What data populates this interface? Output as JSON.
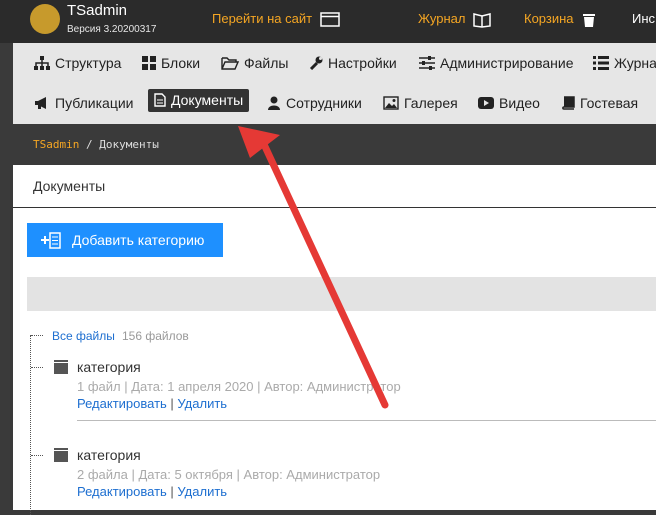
{
  "header": {
    "brand": "TSadmin",
    "version": "Версия 3.20200317",
    "links": [
      "Перейти на сайт",
      "Журнал",
      "Корзина",
      "Инс"
    ]
  },
  "menu1": [
    "Структура",
    "Блоки",
    "Файлы",
    "Настройки",
    "Администрирование",
    "Журна"
  ],
  "menu2": [
    "Публикации",
    "Документы",
    "Сотрудники",
    "Галерея",
    "Видео",
    "Гостевая"
  ],
  "breadcrumb": {
    "root": "TSadmin",
    "sep": " / ",
    "current": "Документы"
  },
  "content": {
    "title": "Документы",
    "add_button": "Добавить категорию",
    "tree": {
      "all_files": "Все файлы",
      "count": "156 файлов",
      "categories": [
        {
          "name": "категория",
          "meta": "1 файл | Дата: 1 апреля 2020 | Автор: Администратор",
          "edit": "Редактировать",
          "sep": " | ",
          "delete": "Удалить"
        },
        {
          "name": "категория",
          "meta": "2 файла | Дата: 5 октября | Автор: Администратор",
          "edit": "Редактировать",
          "sep": " | ",
          "delete": "Удалить"
        }
      ]
    }
  },
  "colors": {
    "accent": "#f5a623",
    "button": "#1e90ff",
    "link": "#1e6fd0",
    "arrow": "#e53935"
  }
}
